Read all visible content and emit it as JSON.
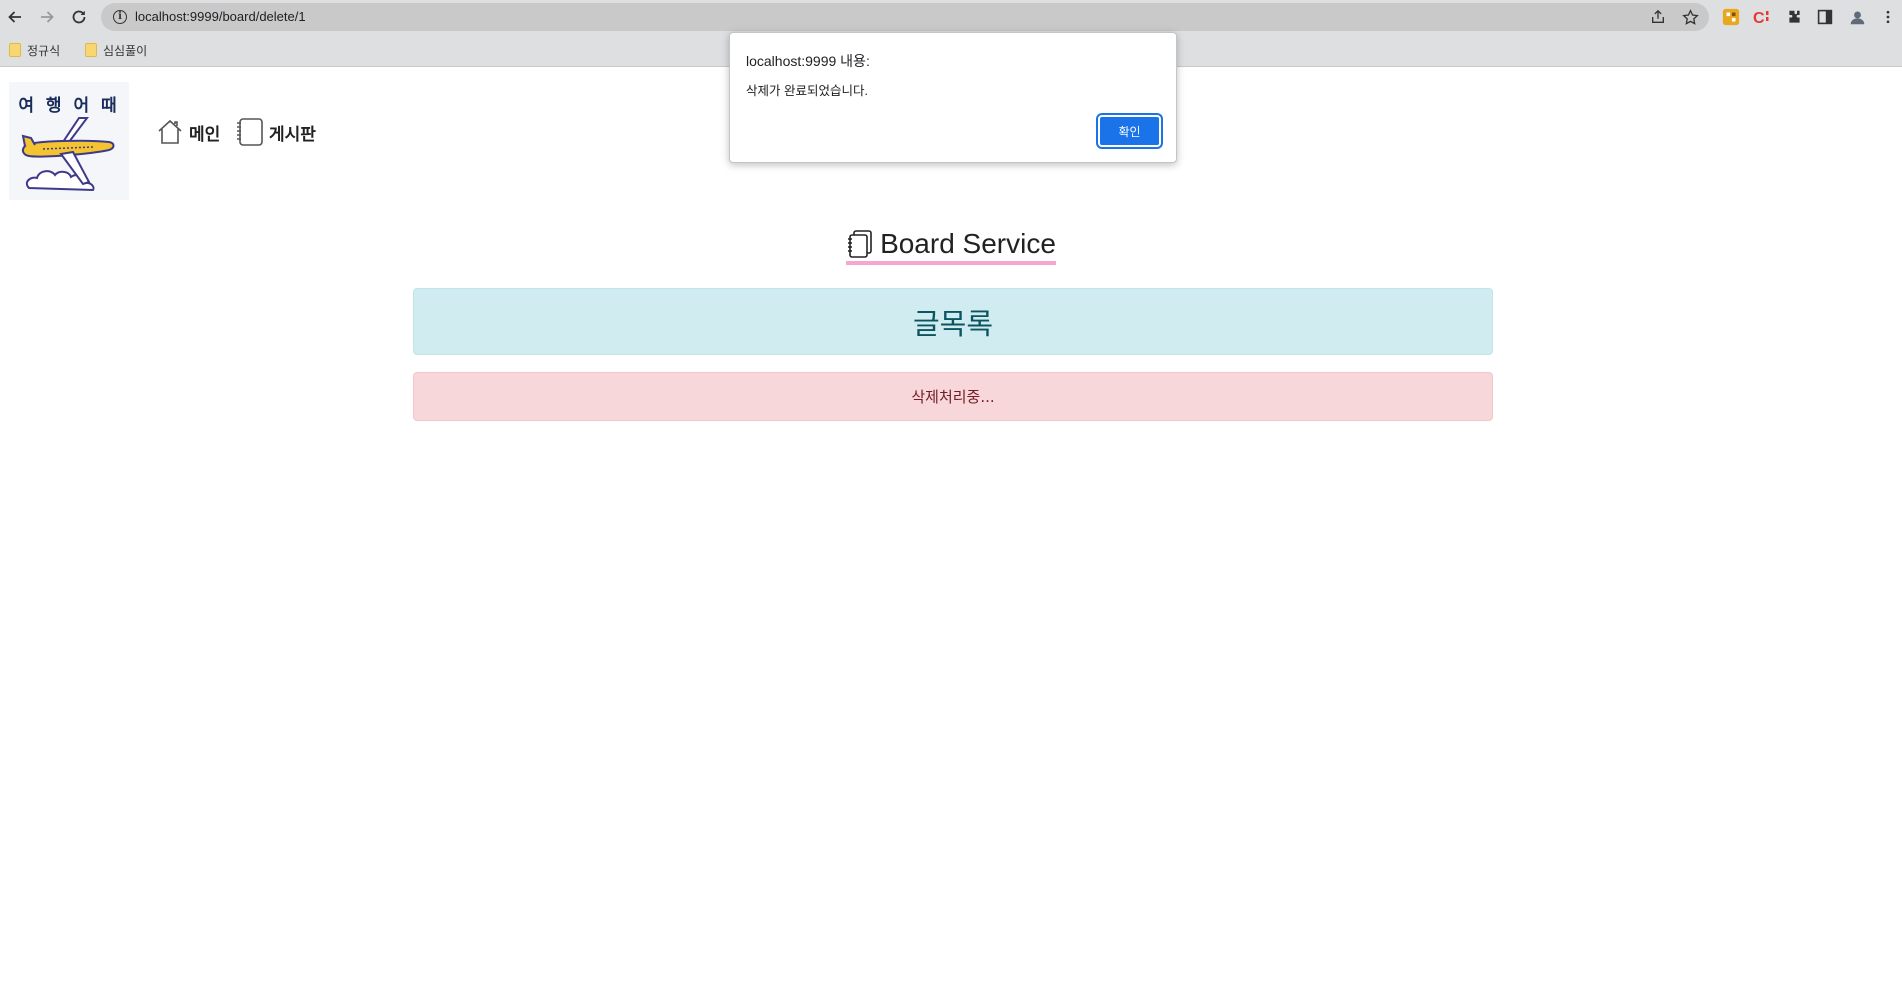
{
  "browser": {
    "url": "localhost:9999/board/delete/1",
    "bookmarks": [
      {
        "label": "정규식"
      },
      {
        "label": "심심풀이"
      }
    ]
  },
  "site": {
    "logo_text": "여 행 어 때",
    "nav": [
      {
        "label": "메인",
        "icon": "home-icon"
      },
      {
        "label": "게시판",
        "icon": "notebook-icon"
      }
    ]
  },
  "main": {
    "heading": "Board Service",
    "list_banner": "글목록",
    "status_message": "삭제처리중..."
  },
  "dialog": {
    "title": "localhost:9999 내용:",
    "message": "삭제가 완료되었습니다.",
    "ok_label": "확인"
  },
  "colors": {
    "accent": "#1a73e8",
    "info_bg": "#d1ecf1",
    "info_text": "#0c5460",
    "danger_bg": "#f8d7da",
    "danger_text": "#721c24",
    "heading_underline": "#f4a7d1"
  }
}
